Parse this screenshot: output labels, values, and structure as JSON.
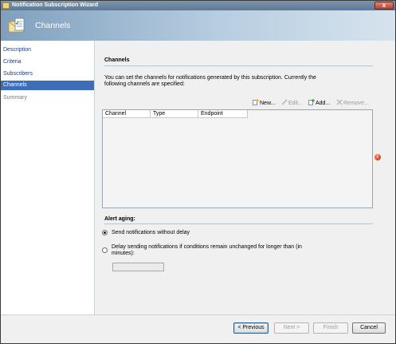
{
  "window": {
    "title": "Notification Subscription Wizard",
    "close_label": "x"
  },
  "header": {
    "title": "Channels",
    "icon": "envelope-document-icon"
  },
  "nav": {
    "items": [
      {
        "label": "Description",
        "state": "normal"
      },
      {
        "label": "Criteria",
        "state": "normal"
      },
      {
        "label": "Subscribers",
        "state": "normal"
      },
      {
        "label": "Channels",
        "state": "active"
      },
      {
        "label": "Summary",
        "state": "disabled"
      }
    ]
  },
  "channels": {
    "heading": "Channels",
    "description": "You can set the channels for notifications generated by this subscription.  Currently the following channels are specified:",
    "toolbar": {
      "new_label": "New...",
      "edit_label": "Edit...",
      "add_label": "Add...",
      "remove_label": "Remove..."
    },
    "grid": {
      "columns": [
        "Channel",
        "Type",
        "Endpoint"
      ],
      "rows": []
    },
    "error_symbol": "!"
  },
  "alert_aging": {
    "heading": "Alert aging:",
    "option_send": "Send notifications without delay",
    "option_delay": "Delay sending notifications if conditions remain unchanged for longer than (in minutes):",
    "selected": "send",
    "minutes_value": ""
  },
  "footer": {
    "previous_label": "< Previous",
    "next_label": "Next >",
    "finish_label": "Finish",
    "cancel_label": "Cancel"
  },
  "colors": {
    "nav_active": "#3d6fb8",
    "header_gradient_start": "#7fa0be",
    "error": "#c41f0a"
  }
}
